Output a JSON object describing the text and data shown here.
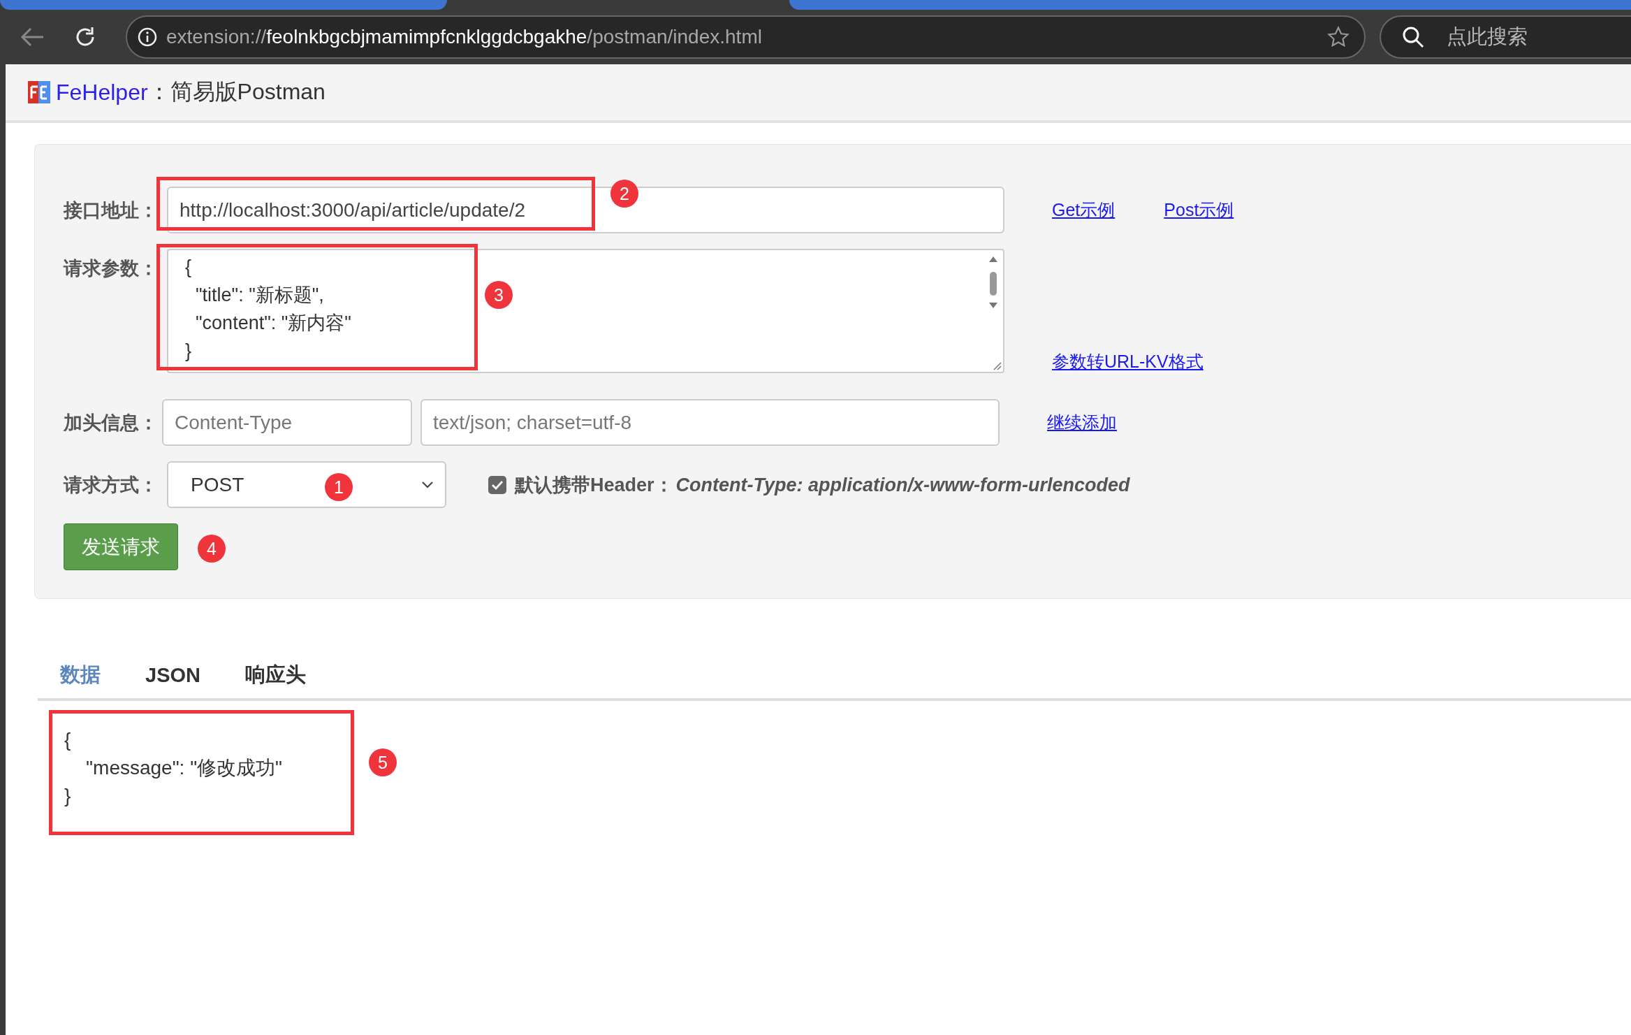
{
  "browser": {
    "url_scheme": "extension://",
    "url_host": "feolnkbgcbjmamimpfcnklggdcbgakhe",
    "url_path": "/postman/index.html",
    "search_placeholder": "点此搜索"
  },
  "header": {
    "brand": "FeHelper",
    "title": "：简易版Postman"
  },
  "form": {
    "url": {
      "label": "接口地址：",
      "value": "http://localhost:3000/api/article/update/2"
    },
    "example_links": [
      "Get示例",
      "Post示例"
    ],
    "params": {
      "label": "请求参数：",
      "lines": [
        "{",
        "  \"title\": \"新标题\",",
        "  \"content\": \"新内容\"",
        "}"
      ]
    },
    "convert_link": "参数转URL-KV格式",
    "headers": {
      "label": "加头信息：",
      "key_placeholder": "Content-Type",
      "value_placeholder": "text/json; charset=utf-8"
    },
    "add_link": "继续添加",
    "method": {
      "label": "请求方式：",
      "value": "POST"
    },
    "default_header": {
      "checked": true,
      "label": "默认携带Header：",
      "value": "Content-Type: application/x-www-form-urlencoded"
    },
    "send_button": "发送请求"
  },
  "result_tabs": [
    {
      "label": "数据",
      "selected": true
    },
    {
      "label": "JSON",
      "selected": false
    },
    {
      "label": "响应头",
      "selected": false
    }
  ],
  "response": {
    "lines": [
      "{",
      "    \"message\": \"修改成功\"",
      "}"
    ]
  },
  "annotations": [
    {
      "number": "2"
    },
    {
      "number": "3"
    },
    {
      "number": "1"
    },
    {
      "number": "4"
    },
    {
      "number": "5"
    }
  ]
}
